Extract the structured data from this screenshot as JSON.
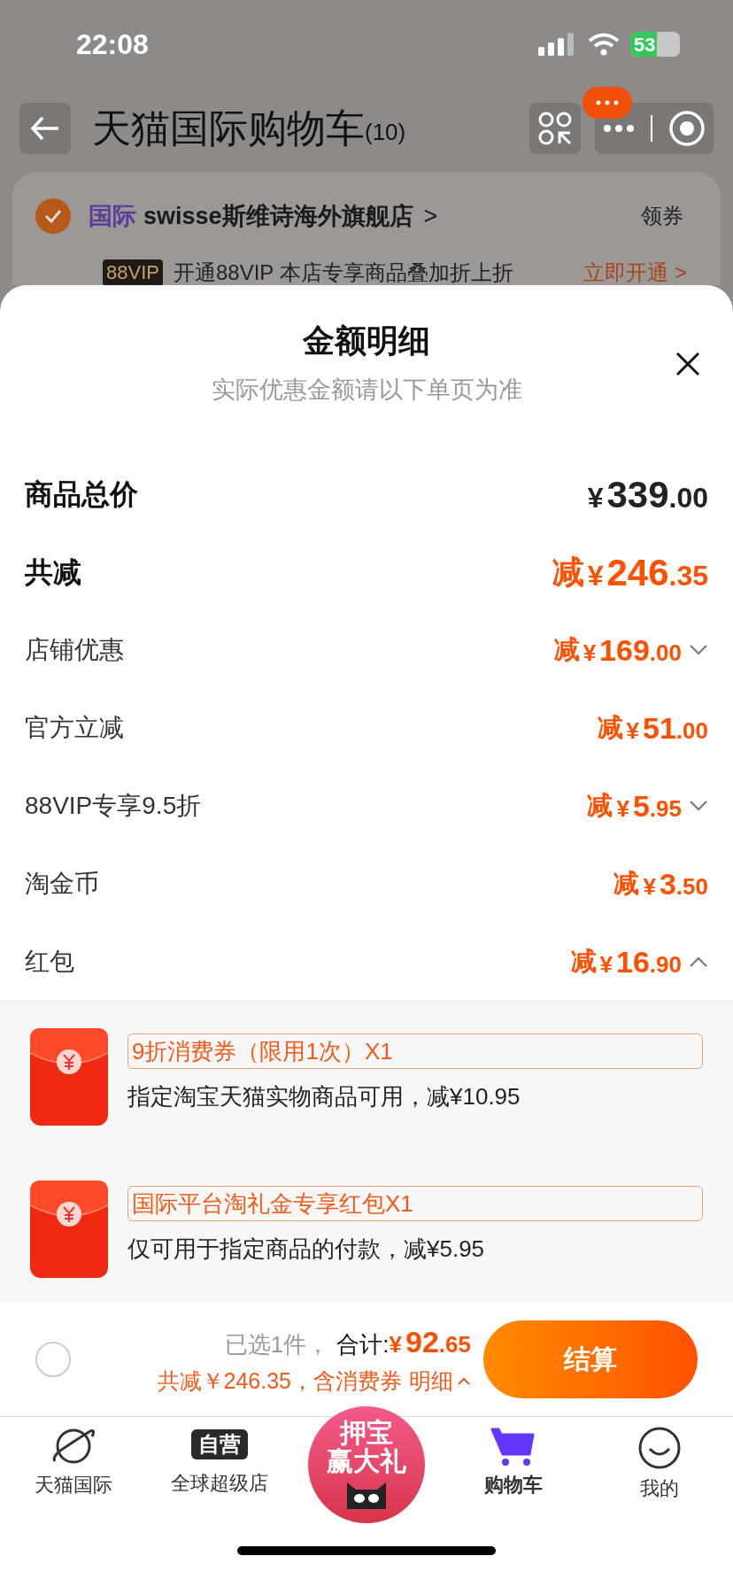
{
  "status_bar": {
    "time": "22:08",
    "battery": "53"
  },
  "header": {
    "title": "天猫国际购物车",
    "count": "(10)"
  },
  "store": {
    "checked": true,
    "tag": "国际",
    "name": "swisse斯维诗海外旗舰店",
    "chevron": ">",
    "coupon": "领券",
    "vip_badge": "88VIP",
    "vip_text": "开通88VIP 本店专享商品叠加折上折",
    "vip_link": "立即开通 >"
  },
  "sheet": {
    "title": "金额明细",
    "subtitle": "实际优惠金额请以下单页为准",
    "rows": [
      {
        "kind": "total",
        "label": "商品总价",
        "amount": "¥339.00"
      },
      {
        "kind": "total",
        "label": "共减",
        "prefix": "减",
        "amount": "¥246.35"
      },
      {
        "kind": "item",
        "label": "店铺优惠",
        "prefix": "减",
        "amount": "¥169.00",
        "expanded": false
      },
      {
        "kind": "item",
        "label": "官方立减",
        "prefix": "减",
        "amount": "¥51.00"
      },
      {
        "kind": "item",
        "label": "88VIP专享9.5折",
        "prefix": "减",
        "amount": "¥5.95",
        "expanded": false
      },
      {
        "kind": "item",
        "label": "淘金币",
        "prefix": "减",
        "amount": "¥3.50"
      },
      {
        "kind": "item",
        "label": "红包",
        "prefix": "减",
        "amount": "¥16.90",
        "expanded": true
      }
    ],
    "coupons": [
      {
        "title": "9折消费券（限用1次）X1",
        "description": "指定淘宝天猫实物商品可用，减¥10.95"
      },
      {
        "title": "国际平台淘礼金专享红包X1",
        "description": "仅可用于指定商品的付款，减¥5.95"
      }
    ]
  },
  "checkout": {
    "checked": false,
    "selected_count": "已选1件，",
    "total_label": "合计:",
    "total": "¥92.65",
    "savings": "共减￥246.35，含消费券",
    "details": "明细",
    "button": "结算"
  },
  "tab_bar": [
    {
      "kind": "planet",
      "label": "天猫国际",
      "selected": false
    },
    {
      "kind": "badge",
      "badge": "自营",
      "label": "全球超级店",
      "selected": false
    },
    {
      "kind": "promo",
      "line1": "押宝",
      "line2": "赢大礼"
    },
    {
      "kind": "cart",
      "label": "购物车",
      "selected": true
    },
    {
      "kind": "face",
      "label": "我的",
      "selected": false
    }
  ]
}
